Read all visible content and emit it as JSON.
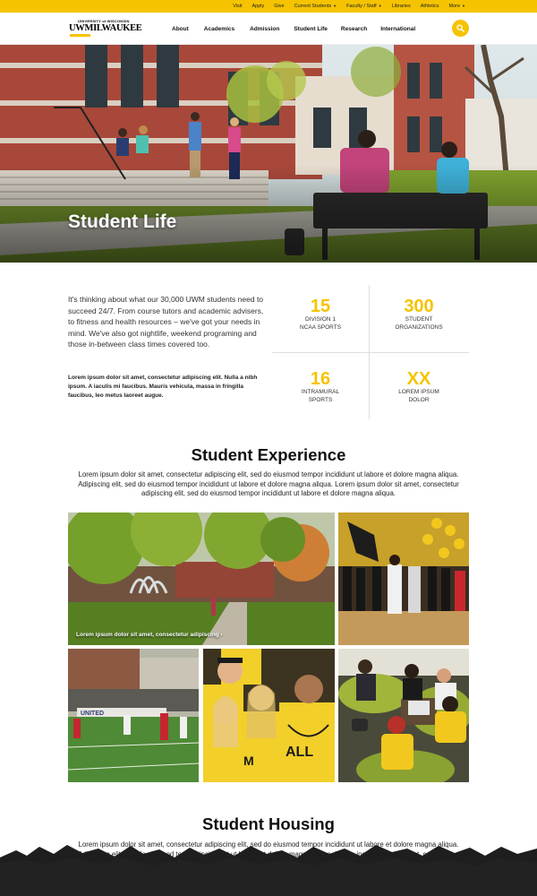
{
  "utility_nav": {
    "items": [
      {
        "label": "Visit",
        "dropdown": false
      },
      {
        "label": "Apply",
        "dropdown": false
      },
      {
        "label": "Give",
        "dropdown": false
      },
      {
        "label": "Current Students",
        "dropdown": true
      },
      {
        "label": "Faculty / Staff",
        "dropdown": true
      },
      {
        "label": "Libraries",
        "dropdown": false
      },
      {
        "label": "Athletics",
        "dropdown": false
      },
      {
        "label": "More",
        "dropdown": true
      }
    ]
  },
  "brand": {
    "top_line": "UNIVERSITY of WISCONSIN",
    "name": "UWMILWAUKEE",
    "accent_color": "#f5c300"
  },
  "main_nav": {
    "items": [
      "About",
      "Academics",
      "Admission",
      "Student Life",
      "Research",
      "International"
    ],
    "search_icon": "search-icon"
  },
  "hero": {
    "title": "Student Life"
  },
  "intro": {
    "text": "It's thinking about what our 30,000 UWM students need to succeed 24/7. From course tutors and academic advisers, to fitness and health resources – we've got your needs in mind. We've also got nightlife, weekend programing and those in-between class times covered too.",
    "small_text": "Lorem ipsum dolor sit amet, consectetur adipiscing elit. Nulla a nibh ipsum. A iaculis mi faucibus. Mauris vehicula, massa in fringilla faucibus, leo metus laoreet augue."
  },
  "stats": [
    {
      "number": "15",
      "label_1": "DIVISION 1",
      "label_2": "NCAA SPORTS"
    },
    {
      "number": "300",
      "label_1": "STUDENT",
      "label_2": "ORGANIZATIONS"
    },
    {
      "number": "16",
      "label_1": "INTRAMURAL",
      "label_2": "SPORTS"
    },
    {
      "number": "XX",
      "label_1": "LOREM IPSUM",
      "label_2": "DOLOR"
    }
  ],
  "experience": {
    "title": "Student Experience",
    "text": "Lorem ipsum dolor sit amet, consectetur adipiscing elit, sed do eiusmod tempor incididunt ut labore et dolore magna aliqua. Adipiscing elit, sed do eiusmod tempor incididunt ut labore et dolore magna aliqua. Lorem ipsum dolor sit amet, consectetur adipiscing elit, sed do eiusmod tempor incididunt ut labore et dolore magna aliqua.",
    "feature_caption": "Lorem ipsum dolor sit amet, consectetur adipiscing ›"
  },
  "housing": {
    "title": "Student Housing",
    "text": "Lorem ipsum dolor sit amet, consectetur adipiscing elit, sed do eiusmod tempor incididunt ut labore et dolore magna aliqua. Adipiscing elit, sed do eiusmod tempor incididunt ut labore et dolore magna aliqua. Lorem ipsum dolor sit amet, consectetur adipiscing elit, sed do eiusmod tempor incididunt ut labore et dolore magna aliqua."
  }
}
